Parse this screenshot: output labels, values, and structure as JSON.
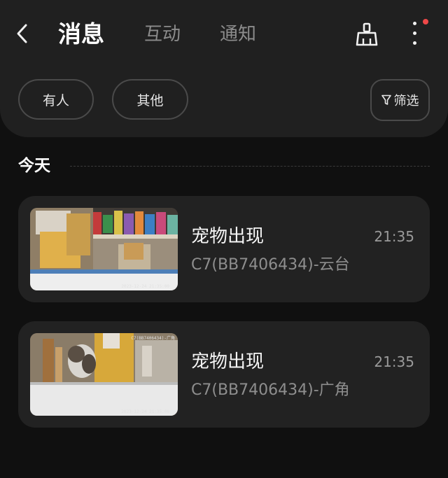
{
  "header": {
    "tabs": [
      {
        "label": "消息",
        "active": true
      },
      {
        "label": "互动",
        "active": false
      },
      {
        "label": "通知",
        "active": false
      }
    ],
    "icons": {
      "back": "chevron-left-icon",
      "clean": "broom-icon",
      "more": "more-vertical-icon"
    },
    "unread_dot_color": "#ef4848"
  },
  "filters": {
    "chips": [
      {
        "label": "有人"
      },
      {
        "label": "其他"
      }
    ],
    "filter_button": {
      "label": "筛选",
      "icon": "funnel-icon"
    }
  },
  "section": {
    "title": "今天"
  },
  "events": [
    {
      "title": "宠物出现",
      "time": "21:35",
      "device": "C7(BB7406434)-云台",
      "thumb_timestamp": "2023-12-24 21:35:00"
    },
    {
      "title": "宠物出现",
      "time": "21:35",
      "device": "C7(BB7406434)-广角",
      "thumb_timestamp": "2023-12-24 21:35:00",
      "thumb_label": "C7(BB7406434)-广角"
    }
  ]
}
